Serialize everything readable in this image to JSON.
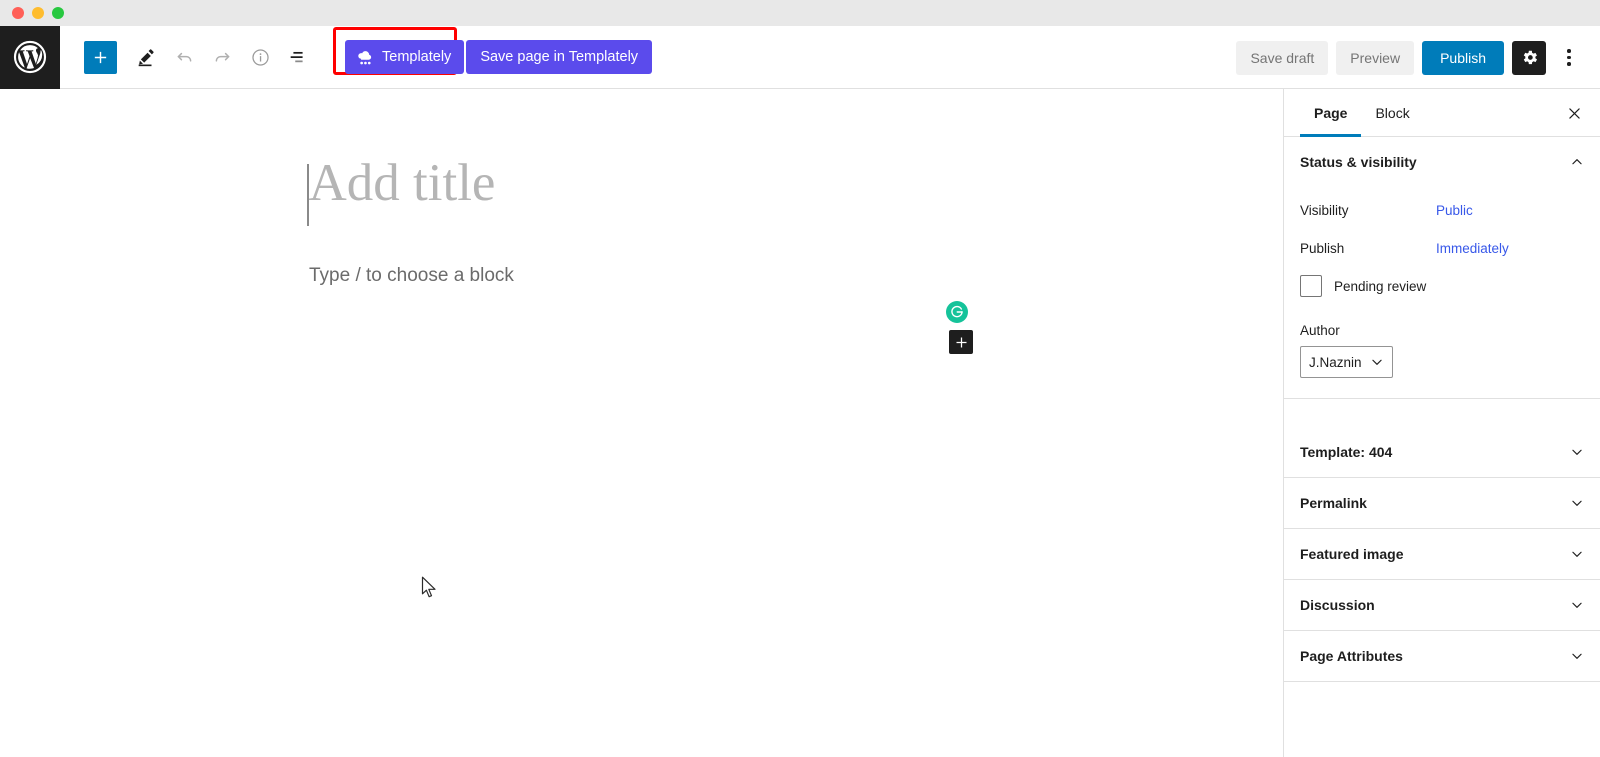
{
  "window": {
    "traffic_lights": [
      {
        "name": "close",
        "color": "#ff5f57"
      },
      {
        "name": "minimize",
        "color": "#febc2e"
      },
      {
        "name": "zoom",
        "color": "#28c840"
      }
    ]
  },
  "toolbar": {
    "logo_name": "wordpress-logo",
    "add_block_label": "+",
    "icons": [
      {
        "name": "add-block-icon",
        "title": "Add block"
      },
      {
        "name": "edit-pen-icon",
        "title": "Tools"
      },
      {
        "name": "undo-icon",
        "title": "Undo"
      },
      {
        "name": "redo-icon",
        "title": "Redo"
      },
      {
        "name": "info-icon",
        "title": "Details"
      },
      {
        "name": "list-view-icon",
        "title": "List view"
      }
    ],
    "templately_label": "Templately",
    "save_in_templately_label": "Save page in Templately",
    "save_draft_label": "Save draft",
    "preview_label": "Preview",
    "publish_label": "Publish",
    "settings_title": "Settings",
    "more_title": "Options",
    "accent_blue": "#007cba",
    "templately_purple": "#5b4bec",
    "highlight_red": "#ff0000"
  },
  "editor": {
    "title_placeholder": "Add title",
    "block_placeholder": "Type / to choose a block",
    "grammarly_label": "G",
    "grammarly_color": "#15c39a",
    "inline_add_label": "+"
  },
  "sidebar": {
    "tabs": [
      {
        "label": "Page",
        "active": true
      },
      {
        "label": "Block",
        "active": false
      }
    ],
    "close_label": "Close settings",
    "status_panel": {
      "title": "Status & visibility",
      "visibility_label": "Visibility",
      "visibility_value": "Public",
      "publish_label": "Publish",
      "publish_value": "Immediately",
      "pending_review_label": "Pending review",
      "pending_review_checked": false,
      "author_label": "Author",
      "author_value": "J.Naznin"
    },
    "panels": [
      {
        "title": "Template: 404"
      },
      {
        "title": "Permalink"
      },
      {
        "title": "Featured image"
      },
      {
        "title": "Discussion"
      },
      {
        "title": "Page Attributes"
      }
    ]
  }
}
